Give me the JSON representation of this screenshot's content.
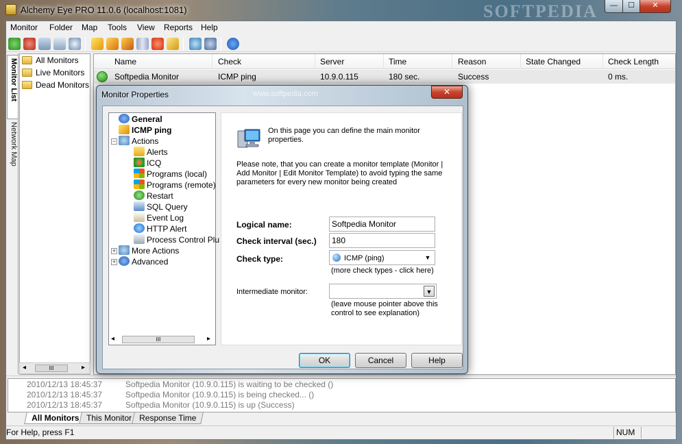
{
  "window": {
    "title": "Alchemy Eye PRO 11.0.6 (localhost:1081)",
    "watermark": "SOFTPEDIA",
    "min_glyph": "—",
    "max_glyph": "☐",
    "close_glyph": "✕"
  },
  "menu": [
    "Monitor",
    "Folder",
    "Map",
    "Tools",
    "View",
    "Reports",
    "Help"
  ],
  "side_tabs": {
    "monitor_list": "Monitor List",
    "network_map": "Network Map"
  },
  "folders": [
    "All Monitors",
    "Live Monitors",
    "Dead Monitors"
  ],
  "scroll": {
    "left": "◂",
    "right": "▸",
    "thumb": "III"
  },
  "list": {
    "columns": [
      "Name",
      "Check",
      "Server",
      "Time",
      "Reason",
      "State Changed",
      "Check Length"
    ],
    "rows": [
      {
        "name": "Softpedia Monitor",
        "check": "ICMP ping",
        "server": "10.9.0.115",
        "time": "180 sec.",
        "reason": "Success",
        "state_changed": "",
        "check_length": "0 ms."
      }
    ]
  },
  "log": [
    {
      "time": "2010/12/13 18:45:37",
      "message": "Softpedia Monitor (10.9.0.115) is waiting to be checked ()"
    },
    {
      "time": "2010/12/13 18:45:37",
      "message": "Softpedia Monitor (10.9.0.115) is being checked... ()"
    },
    {
      "time": "2010/12/13 18:45:37",
      "message": "Softpedia Monitor (10.9.0.115) is up (Success)"
    }
  ],
  "bottom_tabs": [
    "All Monitors",
    "This Monitor",
    "Response Time"
  ],
  "status": {
    "help": "For Help, press F1",
    "num": "NUM"
  },
  "dialog": {
    "title": "Monitor Properties",
    "watermark": "www.softpedia.com",
    "close_glyph": "✕",
    "tree": {
      "general": "General",
      "icmp": "ICMP ping",
      "actions": "Actions",
      "action_items": [
        "Alerts",
        "ICQ",
        "Programs (local)",
        "Programs (remote)",
        "Restart",
        "SQL Query",
        "Event Log",
        "HTTP Alert",
        "Process Control Plu"
      ],
      "more_actions": "More Actions",
      "advanced": "Advanced",
      "expand_minus": "−",
      "expand_plus": "+"
    },
    "panel": {
      "intro": "On this page you can define the main monitor properties.",
      "note": "Please note, that you can create a monitor template (Monitor | Add Monitor | Edit Monitor Template) to avoid typing the same parameters for every new monitor being created",
      "logical_name_label": "Logical name:",
      "logical_name_value": "Softpedia Monitor",
      "interval_label": "Check interval (sec.)",
      "interval_value": "180",
      "check_type_label": "Check type:",
      "check_type_value": "ICMP (ping)",
      "more_types": "(more check types - click here)",
      "intermediate_label": "Intermediate monitor:",
      "intermediate_value": "",
      "intermediate_hint": "(leave mouse pointer above this control to see explanation)",
      "arrow": "▼"
    },
    "buttons": {
      "ok": "OK",
      "cancel": "Cancel",
      "help": "Help"
    }
  }
}
